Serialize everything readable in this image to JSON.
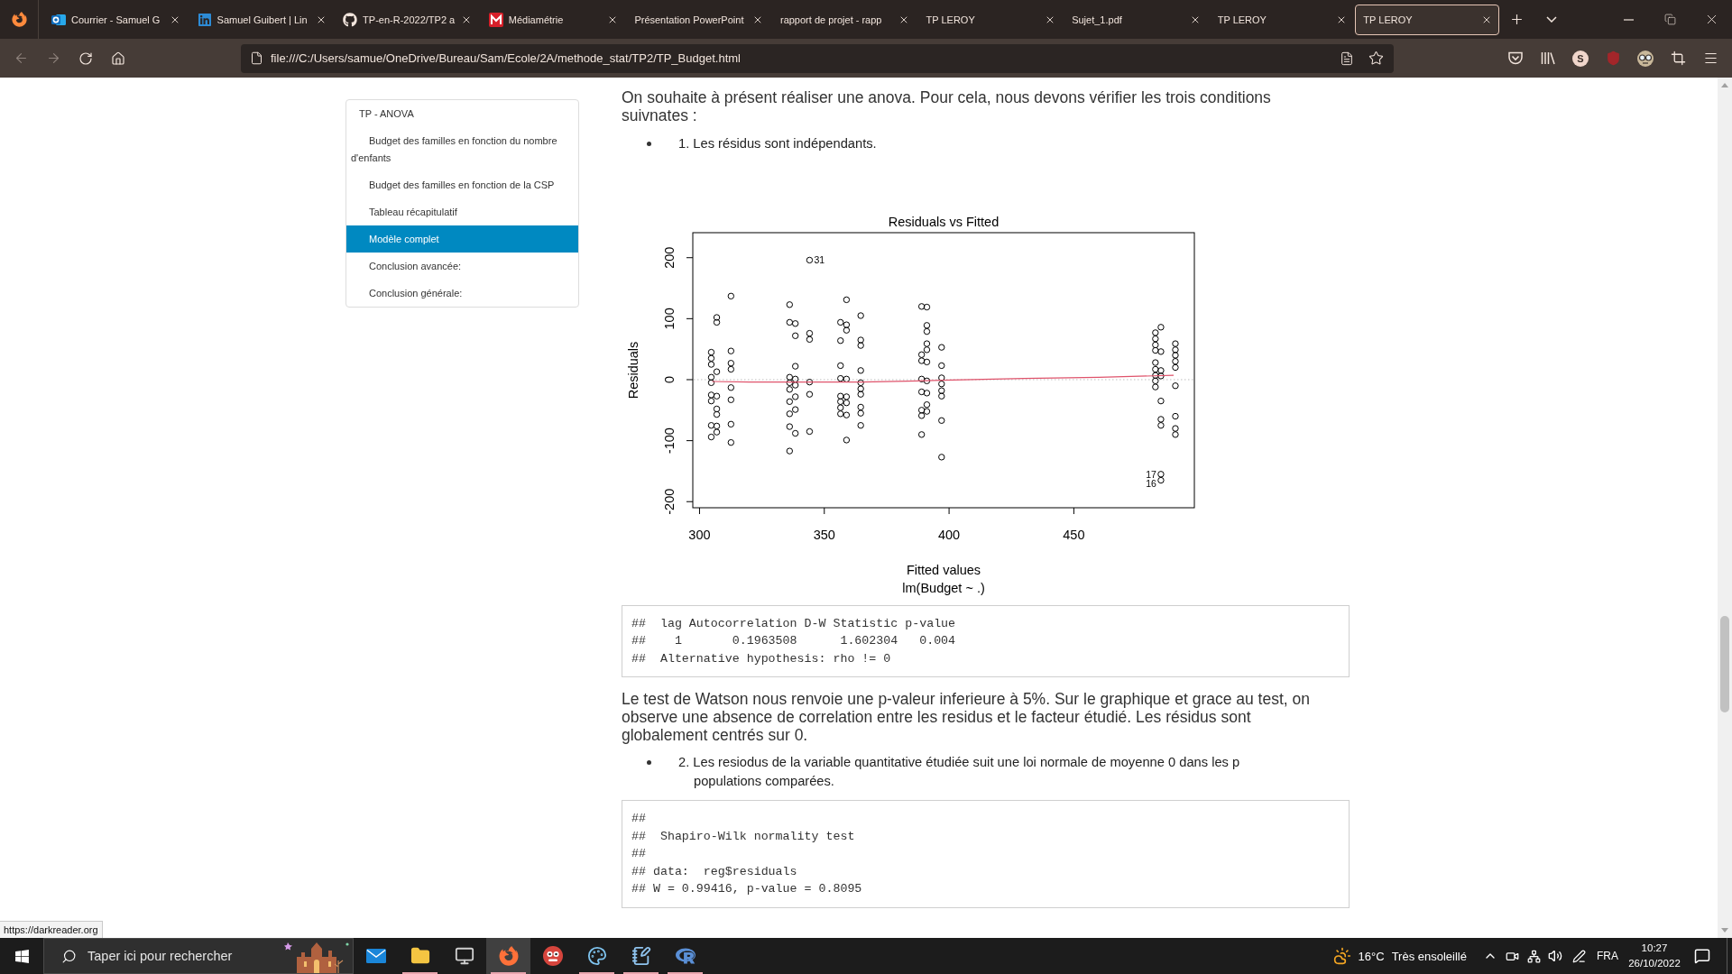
{
  "browser": {
    "tabs": [
      {
        "title": "Courrier - Samuel G",
        "selected": false
      },
      {
        "title": "Samuel Guibert | Lin",
        "selected": false
      },
      {
        "title": "TP-en-R-2022/TP2 a",
        "selected": false
      },
      {
        "title": "Médiamétrie",
        "selected": false
      },
      {
        "title": "Présentation PowerPoint",
        "selected": false
      },
      {
        "title": "rapport de projet - rapp",
        "selected": false
      },
      {
        "title": "TP LEROY",
        "selected": false
      },
      {
        "title": "Sujet_1.pdf",
        "selected": false
      },
      {
        "title": "TP LEROY",
        "selected": false
      },
      {
        "title": "TP LEROY",
        "selected": true
      }
    ],
    "back_disabled": true,
    "forward_disabled": true,
    "url": "file:///C:/Users/samue/OneDrive/Bureau/Sam/Ecole/2A/methode_stat/TP2/TP_Budget.html",
    "extension_badge": "S",
    "status_link": "https://darkreader.org"
  },
  "toc": {
    "items": [
      {
        "label": "TP - ANOVA",
        "selected": false,
        "children": [
          {
            "label": "Budget des familles en fonction du nombre d'enfants",
            "selected": false
          },
          {
            "label": "Budget des familles en fonction de la CSP",
            "selected": false
          },
          {
            "label": "Tableau récapitulatif",
            "selected": false
          },
          {
            "label": "Modèle complet",
            "selected": true
          },
          {
            "label": "Conclusion avancée:",
            "selected": false
          },
          {
            "label": "Conclusion générale:",
            "selected": false
          }
        ]
      }
    ]
  },
  "content": [
    {
      "kind": "paragraph",
      "text": "On souhaite à présent réaliser une anova. Pour cela, nous devons vérifier les trois conditions suivnates :"
    },
    {
      "kind": "bullet",
      "text": "1. Les résidus sont indépendants."
    },
    {
      "kind": "figure",
      "chart_data": {
        "type": "scatter",
        "title": "Residuals vs Fitted",
        "xlabel": "Fitted values",
        "subtitle": "lm(Budget ~ .)",
        "ylabel": "Residuals",
        "xlim": [
          297.3,
          498.3
        ],
        "ylim": [
          -210,
          241
        ],
        "xticks": [
          300,
          350,
          400,
          450
        ],
        "yticks": [
          -200,
          -100,
          0,
          100,
          200
        ],
        "series": [
          {
            "type": "scatter",
            "marker": "circle",
            "color": "#000000",
            "x": [
              304.7,
              304.7,
              304.7,
              304.7,
              304.7,
              304.7,
              304.7,
              304.7,
              304.7,
              306.9,
              306.9,
              306.9,
              306.9,
              306.9,
              306.9,
              306.9,
              306.9,
              312.6,
              312.6,
              312.6,
              312.6,
              312.6,
              312.6,
              312.6,
              312.6,
              336.1,
              336.1,
              336.1,
              336.1,
              336.1,
              336.1,
              336.1,
              336.1,
              336.1,
              338.4,
              338.4,
              338.4,
              338.4,
              338.4,
              338.4,
              338.4,
              338.4,
              344.1,
              344.1,
              344.1,
              344.1,
              344.1,
              356.5,
              356.5,
              356.5,
              356.5,
              356.5,
              356.5,
              356.5,
              356.5,
              358.9,
              358.9,
              358.9,
              358.9,
              358.9,
              358.9,
              358.9,
              358.9,
              364.6,
              364.6,
              364.6,
              364.6,
              364.6,
              364.6,
              364.6,
              364.6,
              364.6,
              364.6,
              389,
              389,
              389,
              389,
              389,
              389,
              389,
              389,
              391.1,
              391.1,
              391.1,
              391.1,
              391.1,
              391.1,
              391.1,
              391.1,
              391.1,
              391.1,
              397,
              397,
              397,
              397,
              397,
              397,
              397,
              397,
              482.7,
              482.7,
              482.7,
              482.7,
              482.7,
              482.7,
              482.7,
              482.7,
              482.7,
              484.9,
              484.9,
              484.9,
              484.9,
              484.9,
              484.9,
              484.9,
              490.7,
              490.7,
              490.7,
              490.7,
              490.7,
              490.7,
              490.7,
              490.7,
              490.7
            ],
            "values": [
              45,
              35,
              25,
              4,
              -5,
              -25,
              -35,
              -75,
              -94,
              102,
              94,
              13,
              -27,
              -48,
              -57,
              -76,
              -86,
              137,
              47,
              27,
              17,
              -13,
              -33,
              -73,
              -103,
              123,
              94,
              4,
              -5,
              -16,
              -36,
              -56,
              -77,
              -117,
              92,
              72,
              22,
              1,
              -9,
              -28,
              -49,
              -88,
              76,
              66,
              -4,
              -24,
              -85,
              94,
              64,
              23,
              2,
              -27,
              -36,
              -46,
              -56,
              131,
              90,
              81,
              1,
              -28,
              -38,
              -58,
              -99,
              105,
              65,
              56,
              15,
              -5,
              -15,
              -24,
              -45,
              -55,
              -75,
              120,
              41,
              31,
              1,
              -20,
              -50,
              -59,
              -90,
              119,
              89,
              79,
              59,
              49,
              29,
              -2,
              -22,
              -41,
              -52,
              53,
              23,
              3,
              -7,
              -18,
              -27,
              -67,
              -127,
              77,
              67,
              57,
              48,
              28,
              17,
              7,
              -2,
              -12,
              86,
              46,
              15,
              6,
              -35,
              -65,
              -75,
              59,
              49,
              40,
              30,
              20,
              -10,
              -60,
              -80,
              -90
            ]
          },
          {
            "type": "scatter",
            "name": "31",
            "marker": "circle",
            "color": "#000000",
            "x": [
              344.1
            ],
            "values": [
              196
            ]
          },
          {
            "type": "scatter",
            "name": "17",
            "marker": "circle",
            "color": "#000000",
            "x": [
              484.9
            ],
            "values": [
              -155
            ]
          },
          {
            "type": "scatter",
            "name": "16",
            "marker": "circle",
            "color": "#000000",
            "x": [
              484.9
            ],
            "values": [
              -165
            ]
          },
          {
            "type": "line",
            "color": "#df536b",
            "x": [
              305,
              320,
              340,
              365,
              397,
              430,
              460,
              490
            ],
            "values": [
              -3,
              -4,
              -4,
              -4,
              -1,
              2,
              4,
              7
            ]
          }
        ],
        "ref_lines": [
          {
            "axis": "y",
            "value": 0,
            "color": "#bebebe",
            "line_style": "dotted"
          }
        ]
      }
    },
    {
      "kind": "code",
      "lines": [
        "##  lag Autocorrelation D-W Statistic p-value",
        "##    1       0.1963508      1.602304   0.004",
        "##  Alternative hypothesis: rho != 0"
      ]
    },
    {
      "kind": "paragraph",
      "text": "Le test de Watson nous renvoie une p-valeur inferieure à 5%. Sur le graphique et grace au test, on observe une absence de correlation entre les residus et le facteur étudié. Les résidus sont globalement centrés sur 0."
    },
    {
      "kind": "bullet",
      "text": "2. Les resiodus de la variable quantitative étudiée suit une loi normale de moyenne 0 dans les p populations comparées."
    },
    {
      "kind": "code",
      "lines": [
        "##",
        "##  Shapiro-Wilk normality test",
        "##",
        "## data:  reg$residuals",
        "## W = 0.99416, p-value = 0.8095"
      ]
    }
  ],
  "taskbar": {
    "search": {
      "placeholder": "Taper ici pour rechercher"
    },
    "apps": [
      {
        "running": false,
        "selected": false
      },
      {
        "running": true,
        "selected": false
      },
      {
        "running": false,
        "selected": false
      },
      {
        "running": true,
        "selected": true
      },
      {
        "running": false,
        "selected": false
      },
      {
        "running": true,
        "selected": false
      },
      {
        "running": true,
        "selected": false
      },
      {
        "running": true,
        "selected": false
      }
    ],
    "weather": {
      "temperature": "16°C",
      "condition": "Très ensoleillé"
    },
    "language": "FRA",
    "time": "10:27",
    "date": "26/10/2022"
  }
}
